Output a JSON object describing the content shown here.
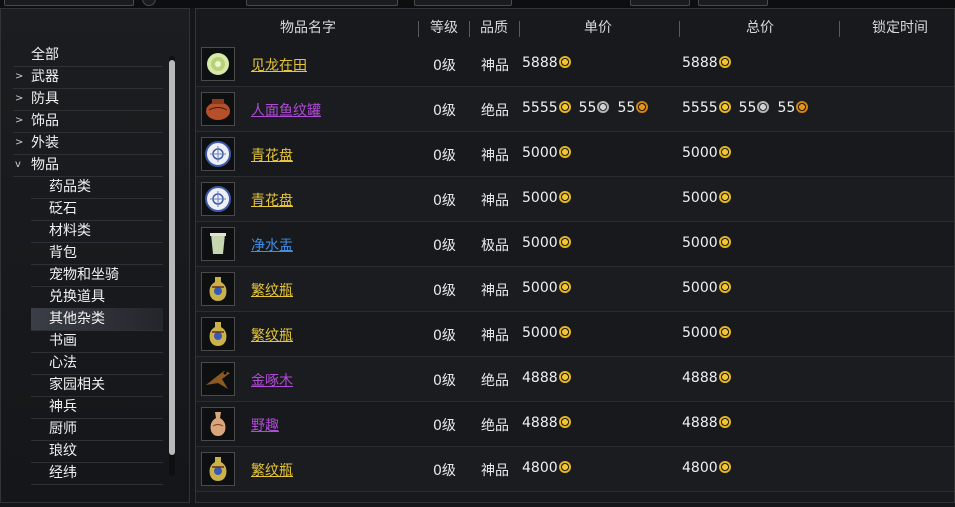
{
  "columns": {
    "name": "物品名字",
    "level": "等级",
    "quality": "品质",
    "unit_price": "单价",
    "total_price": "总价",
    "lock_time": "锁定时间"
  },
  "categories": [
    {
      "label": "全部",
      "arrow": "",
      "indent": false,
      "selected": false
    },
    {
      "label": "武器",
      "arrow": ">",
      "indent": false,
      "selected": false
    },
    {
      "label": "防具",
      "arrow": ">",
      "indent": false,
      "selected": false
    },
    {
      "label": "饰品",
      "arrow": ">",
      "indent": false,
      "selected": false
    },
    {
      "label": "外装",
      "arrow": ">",
      "indent": false,
      "selected": false
    },
    {
      "label": "物品",
      "arrow": "v",
      "indent": false,
      "selected": false
    },
    {
      "label": "药品类",
      "arrow": "",
      "indent": true,
      "selected": false
    },
    {
      "label": "砭石",
      "arrow": "",
      "indent": true,
      "selected": false
    },
    {
      "label": "材料类",
      "arrow": "",
      "indent": true,
      "selected": false
    },
    {
      "label": "背包",
      "arrow": "",
      "indent": true,
      "selected": false
    },
    {
      "label": "宠物和坐骑",
      "arrow": "",
      "indent": true,
      "selected": false
    },
    {
      "label": "兑换道具",
      "arrow": "",
      "indent": true,
      "selected": false
    },
    {
      "label": "其他杂类",
      "arrow": "",
      "indent": true,
      "selected": true
    },
    {
      "label": "书画",
      "arrow": "",
      "indent": true,
      "selected": false
    },
    {
      "label": "心法",
      "arrow": "",
      "indent": true,
      "selected": false
    },
    {
      "label": "家园相关",
      "arrow": "",
      "indent": true,
      "selected": false
    },
    {
      "label": "神兵",
      "arrow": "",
      "indent": true,
      "selected": false
    },
    {
      "label": "厨师",
      "arrow": "",
      "indent": true,
      "selected": false
    },
    {
      "label": "琅纹",
      "arrow": "",
      "indent": true,
      "selected": false
    },
    {
      "label": "经纬",
      "arrow": "",
      "indent": true,
      "selected": false
    }
  ],
  "items": [
    {
      "icon": "jade-disc-icon",
      "name": "见龙在田",
      "quality_class": "q-shen",
      "level": "0级",
      "quality": "神品",
      "unit": {
        "gold": "5888",
        "silver": "",
        "copper": ""
      },
      "total": {
        "gold": "5888",
        "silver": "",
        "copper": ""
      }
    },
    {
      "icon": "clay-jar-icon",
      "name": "人面鱼纹罐",
      "quality_class": "q-jue",
      "level": "0级",
      "quality": "绝品",
      "unit": {
        "gold": "5555",
        "silver": "55",
        "copper": "55"
      },
      "total": {
        "gold": "5555",
        "silver": "55",
        "copper": "55"
      }
    },
    {
      "icon": "blue-white-plate-icon",
      "name": "青花盘",
      "quality_class": "q-shen",
      "level": "0级",
      "quality": "神品",
      "unit": {
        "gold": "5000",
        "silver": "",
        "copper": ""
      },
      "total": {
        "gold": "5000",
        "silver": "",
        "copper": ""
      }
    },
    {
      "icon": "blue-white-plate-icon",
      "name": "青花盘",
      "quality_class": "q-shen",
      "level": "0级",
      "quality": "神品",
      "unit": {
        "gold": "5000",
        "silver": "",
        "copper": ""
      },
      "total": {
        "gold": "5000",
        "silver": "",
        "copper": ""
      }
    },
    {
      "icon": "celadon-cup-icon",
      "name": "净水盂",
      "quality_class": "q-ji",
      "level": "0级",
      "quality": "极品",
      "unit": {
        "gold": "5000",
        "silver": "",
        "copper": ""
      },
      "total": {
        "gold": "5000",
        "silver": "",
        "copper": ""
      }
    },
    {
      "icon": "ornate-vase-icon",
      "name": "繁纹瓶",
      "quality_class": "q-shen",
      "level": "0级",
      "quality": "神品",
      "unit": {
        "gold": "5000",
        "silver": "",
        "copper": ""
      },
      "total": {
        "gold": "5000",
        "silver": "",
        "copper": ""
      }
    },
    {
      "icon": "ornate-vase-icon",
      "name": "繁纹瓶",
      "quality_class": "q-shen",
      "level": "0级",
      "quality": "神品",
      "unit": {
        "gold": "5000",
        "silver": "",
        "copper": ""
      },
      "total": {
        "gold": "5000",
        "silver": "",
        "copper": ""
      }
    },
    {
      "icon": "wooden-bird-icon",
      "name": "金啄木",
      "quality_class": "q-jue",
      "level": "0级",
      "quality": "绝品",
      "unit": {
        "gold": "4888",
        "silver": "",
        "copper": ""
      },
      "total": {
        "gold": "4888",
        "silver": "",
        "copper": ""
      }
    },
    {
      "icon": "pottery-vase-icon",
      "name": "野趣",
      "quality_class": "q-jue",
      "level": "0级",
      "quality": "绝品",
      "unit": {
        "gold": "4888",
        "silver": "",
        "copper": ""
      },
      "total": {
        "gold": "4888",
        "silver": "",
        "copper": ""
      }
    },
    {
      "icon": "ornate-vase-icon",
      "name": "繁纹瓶",
      "quality_class": "q-shen",
      "level": "0级",
      "quality": "神品",
      "unit": {
        "gold": "4800",
        "silver": "",
        "copper": ""
      },
      "total": {
        "gold": "4800",
        "silver": "",
        "copper": ""
      }
    }
  ],
  "colors": {
    "divine": "#e6c53a",
    "supreme": "#b04ad8",
    "excellent": "#3f8ee6",
    "gold_coin": "#f1c531",
    "silver_coin": "#cfcfcf",
    "copper_coin": "#e0951f"
  }
}
